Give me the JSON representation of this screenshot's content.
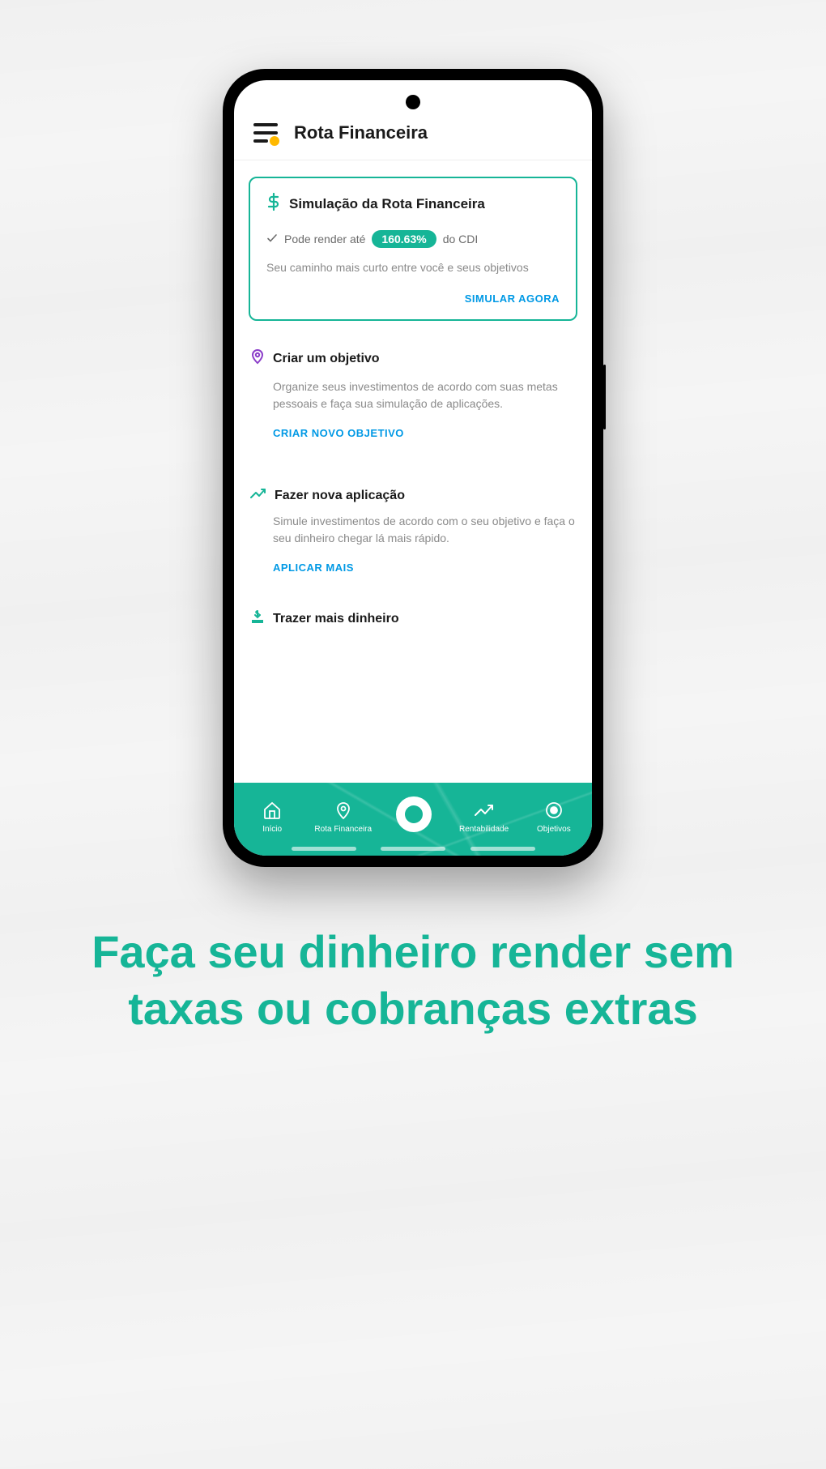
{
  "header": {
    "title": "Rota Financeira"
  },
  "simulation": {
    "title": "Simulação da Rota Financeira",
    "render_prefix": "Pode render até",
    "percentage": "160.63%",
    "render_suffix": "do CDI",
    "subtitle": "Seu caminho mais curto entre você e seus objetivos",
    "action": "SIMULAR AGORA"
  },
  "sections": [
    {
      "title": "Criar um objetivo",
      "desc": "Organize seus investimentos de acordo com suas metas pessoais e faça sua simulação de aplicações.",
      "action": "CRIAR NOVO OBJETIVO"
    },
    {
      "title": "Fazer nova aplicação",
      "desc": "Simule investimentos de acordo com o seu objetivo e faça o seu dinheiro chegar lá mais rápido.",
      "action": "APLICAR MAIS"
    },
    {
      "title": "Trazer mais dinheiro",
      "desc": "",
      "action": ""
    }
  ],
  "nav": {
    "items": [
      {
        "label": "Início"
      },
      {
        "label": "Rota Financeira"
      },
      {
        "label": ""
      },
      {
        "label": "Rentabilidade"
      },
      {
        "label": "Objetivos"
      }
    ]
  },
  "tagline": "Faça seu dinheiro render sem taxas ou cobranças extras"
}
